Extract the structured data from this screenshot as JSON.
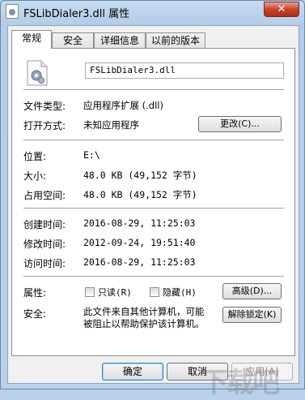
{
  "window": {
    "title": "FSLibDialer3.dll 属性",
    "close_label": "✕"
  },
  "tabs": [
    {
      "label": "常规",
      "active": true
    },
    {
      "label": "安全",
      "active": false
    },
    {
      "label": "详细信息",
      "active": false
    },
    {
      "label": "以前的版本",
      "active": false
    }
  ],
  "general": {
    "file_name": "FSLibDialer3.dll",
    "file_type_label": "文件类型:",
    "file_type_value": "应用程序扩展 (.dll)",
    "opens_with_label": "打开方式:",
    "opens_with_value": "未知应用程序",
    "change_button": "更改(C)...",
    "location_label": "位置:",
    "location_value": "E:\\",
    "size_label": "大小:",
    "size_value": "48.0 KB (49,152 字节)",
    "size_on_disk_label": "占用空间:",
    "size_on_disk_value": "48.0 KB (49,152 字节)",
    "created_label": "创建时间:",
    "created_value": "2016-08-29, 11:25:03",
    "modified_label": "修改时间:",
    "modified_value": "2012-09-24, 19:51:40",
    "accessed_label": "访问时间:",
    "accessed_value": "2016-08-29, 11:25:03",
    "attributes_label": "属性:",
    "readonly_label": "只读(R)",
    "hidden_label": "隐藏(H)",
    "advanced_button": "高级(D)...",
    "security_label": "安全:",
    "security_text_1": "此文件来自其他计算机，可能",
    "security_text_2": "被阻止以帮助保护该计算机。",
    "unblock_button": "解除锁定(K)"
  },
  "footer": {
    "ok": "确定",
    "cancel": "取消",
    "apply": "应用(A)"
  },
  "watermark": "下载吧"
}
